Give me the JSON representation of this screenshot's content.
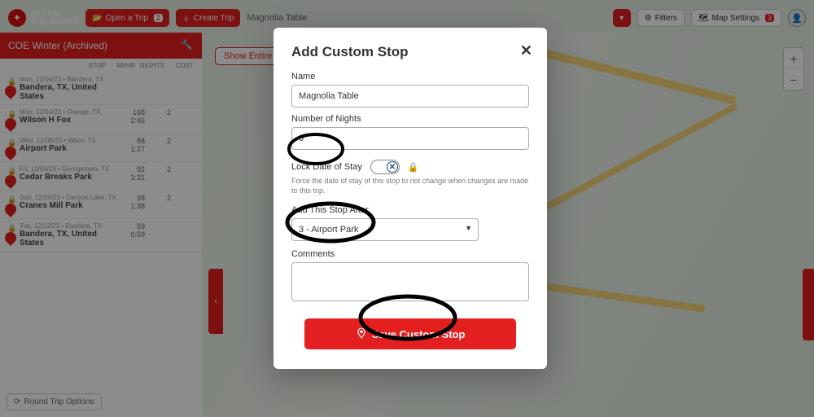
{
  "brand": {
    "line1": "RV LIFE",
    "line2": "Trip Wizard"
  },
  "toolbar": {
    "open_trip": "Open a Trip",
    "open_badge": "2",
    "create_trip": "Create Trip"
  },
  "search_text": "Magnolia Table",
  "right_buttons": {
    "filters": "Filters",
    "map_settings": "Map Settings",
    "map_badge": "3"
  },
  "trip": {
    "name": "COE Winter (Archived)"
  },
  "col_headers": {
    "stop": "STOP",
    "mihr": "MI/HR",
    "nights": "NIGHTS",
    "cost": "COST"
  },
  "stops": [
    {
      "meta": "Mon, 12/04/23 • Bandera, TX",
      "name": "Bandera, TX, United States",
      "mi": "",
      "hr": "",
      "nights": ""
    },
    {
      "meta": "Mon, 12/04/23 • Orange, TX",
      "name": "Wilson H Fox",
      "mi": "168",
      "hr": "2:46",
      "nights": "2"
    },
    {
      "meta": "Wed, 12/06/23 • Waco, TX",
      "name": "Airport Park",
      "mi": "88",
      "hr": "1:27",
      "nights": "2"
    },
    {
      "meta": "Fri, 12/08/23 • Georgetown, TX",
      "name": "Cedar Breaks Park",
      "mi": "92",
      "hr": "1:31",
      "nights": "2"
    },
    {
      "meta": "Sun, 12/10/23 • Canyon Lake, TX",
      "name": "Cranes Mill Park",
      "mi": "98",
      "hr": "1:38",
      "nights": "2"
    },
    {
      "meta": "Tue, 12/12/23 • Bandera, TX",
      "name": "Bandera, TX, United States",
      "mi": "59",
      "hr": "0:59",
      "nights": ""
    }
  ],
  "round_trip": "Round Trip Options",
  "show_entire": "Show Entire",
  "modal": {
    "title": "Add Custom Stop",
    "name_label": "Name",
    "name_value": "Magnolia Table",
    "nights_label": "Number of Nights",
    "nights_value": "0",
    "lock_label": "Lock Date of Stay",
    "lock_hint": "Force the date of stay of this stop to not change when changes are made to this trip.",
    "after_label": "Add This Stop After",
    "after_value": "3 - Airport Park",
    "comments_label": "Comments",
    "save": "Save Custom Stop"
  }
}
